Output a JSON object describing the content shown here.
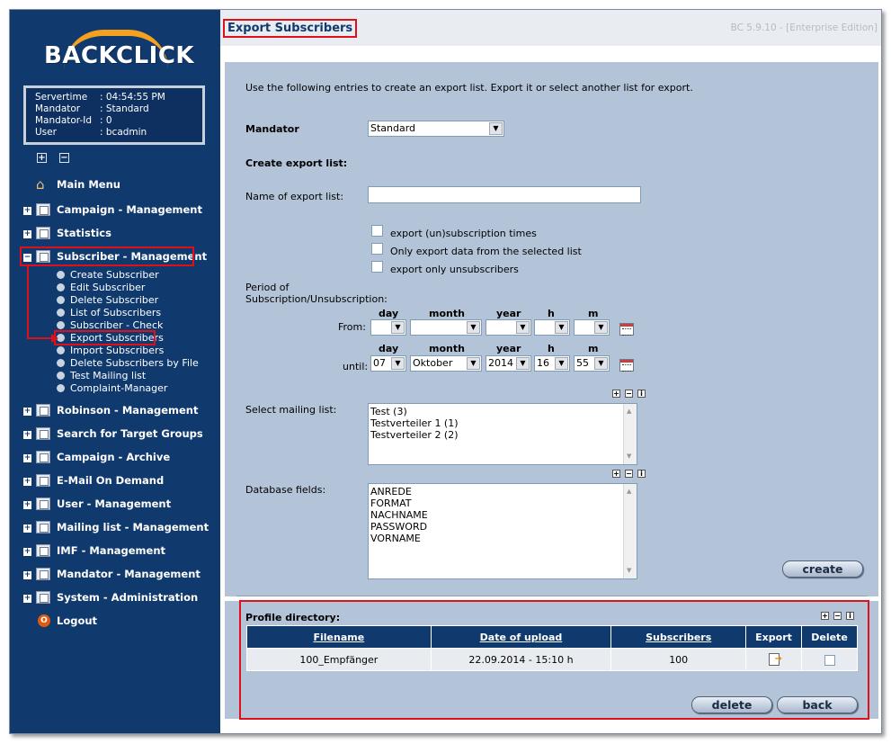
{
  "brand": {
    "logo_text": "BACKCLICK"
  },
  "session": {
    "rows": [
      {
        "key": "Servertime",
        "value": ": 04:54:55 PM"
      },
      {
        "key": "Mandator",
        "value": ": Standard"
      },
      {
        "key": "Mandator-Id",
        "value": ": 0"
      },
      {
        "key": "User",
        "value": ": bcadmin"
      }
    ]
  },
  "sidebar": {
    "expand_symbol": "+",
    "collapse_symbol": "−",
    "main_menu": "Main Menu",
    "items": [
      "Campaign - Management",
      "Statistics",
      "Subscriber - Management",
      "Robinson - Management",
      "Search for Target Groups",
      "Campaign - Archive",
      "E-Mail On Demand",
      "User - Management",
      "Mailing list - Management",
      "IMF - Management",
      "Mandator - Management",
      "System - Administration"
    ],
    "subitems": [
      "Create Subscriber",
      "Edit Subscriber",
      "Delete Subscriber",
      "List of Subscribers",
      "Subscriber - Check",
      "Export Subscribers",
      "Import Subscribers",
      "Delete Subscribers by File",
      "Test Mailing list",
      "Complaint-Manager"
    ],
    "logout": "Logout"
  },
  "header": {
    "title": "Export Subscribers",
    "version": "BC 5.9.10 - [Enterprise Edition]"
  },
  "form": {
    "intro": "Use the following entries to create an export list. Export it or select another list for export.",
    "mandator_label": "Mandator",
    "mandator_value": "Standard",
    "create_heading": "Create export list:",
    "name_label": "Name of export list:",
    "name_value": "",
    "checkboxes": [
      "export (un)subscription times",
      "Only export data from the selected list",
      "export only unsubscribers"
    ],
    "period_label_1": "Period of",
    "period_label_2": "Subscription/Unsubscription:",
    "date_headers": {
      "day": "day",
      "month": "month",
      "year": "year",
      "h": "h",
      "m": "m"
    },
    "from_label": "From:",
    "until_label": "until:",
    "from": {
      "day": "",
      "month": "",
      "year": "",
      "h": "",
      "m": ""
    },
    "until": {
      "day": "07",
      "month": "Oktober",
      "year": "2014",
      "h": "16",
      "m": "55"
    },
    "mailing_label": "Select mailing list:",
    "mailing_lists": [
      "Test (3)",
      "Testverteiler 1 (1)",
      "Testverteiler 2 (2)"
    ],
    "db_label": "Database fields:",
    "db_fields": [
      "ANREDE",
      "FORMAT",
      "NACHNAME",
      "PASSWORD",
      "VORNAME"
    ],
    "create_button": "create",
    "mini_buttons": [
      "+",
      "−",
      "i"
    ]
  },
  "profile": {
    "heading": "Profile directory:",
    "columns": [
      "Filename",
      "Date of upload",
      "Subscribers",
      "Export",
      "Delete"
    ],
    "rows": [
      {
        "filename": "100_Empfänger",
        "date": "22.09.2014 - 15:10 h",
        "subscribers": "100"
      }
    ],
    "delete_button": "delete",
    "back_button": "back"
  },
  "colors": {
    "sidebar": "#103a6e",
    "panel": "#b3c4d8",
    "highlight": "#e0101a",
    "accent": "#f5a01e"
  }
}
